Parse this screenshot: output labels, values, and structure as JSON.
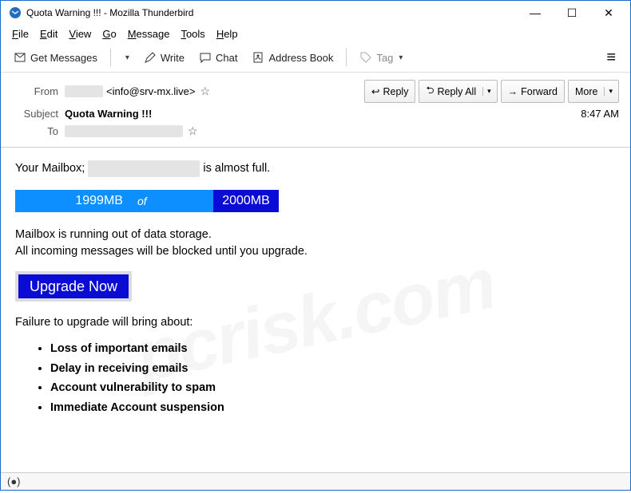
{
  "window": {
    "title": "Quota Warning !!! - Mozilla Thunderbird"
  },
  "menu": {
    "file": "File",
    "edit": "Edit",
    "view": "View",
    "go": "Go",
    "message": "Message",
    "tools": "Tools",
    "help": "Help"
  },
  "toolbar": {
    "get_messages": "Get Messages",
    "write": "Write",
    "chat": "Chat",
    "address_book": "Address Book",
    "tag": "Tag"
  },
  "header": {
    "from_label": "From",
    "from_email": "<info@srv-mx.live>",
    "subject_label": "Subject",
    "subject_value": "Quota Warning !!!",
    "to_label": "To",
    "time": "8:47 AM",
    "actions": {
      "reply": "Reply",
      "reply_all": "Reply All",
      "forward": "Forward",
      "more": "More"
    }
  },
  "body": {
    "line1_prefix": "Your Mailbox; ",
    "line1_suffix": " is almost full.",
    "quota_used": "1999MB",
    "quota_of": "of",
    "quota_total": "2000MB",
    "warn1": "Mailbox is running out of data storage.",
    "warn2": "All incoming messages will be blocked until you upgrade.",
    "upgrade": "Upgrade Now",
    "failure_intro": "Failure to upgrade will bring about:",
    "consequences": [
      "Loss of important emails",
      "Delay in receiving emails",
      "Account vulnerability to spam",
      "Immediate Account suspension"
    ]
  },
  "status": {
    "icon": "(●)"
  },
  "watermark": "pcrisk.com"
}
